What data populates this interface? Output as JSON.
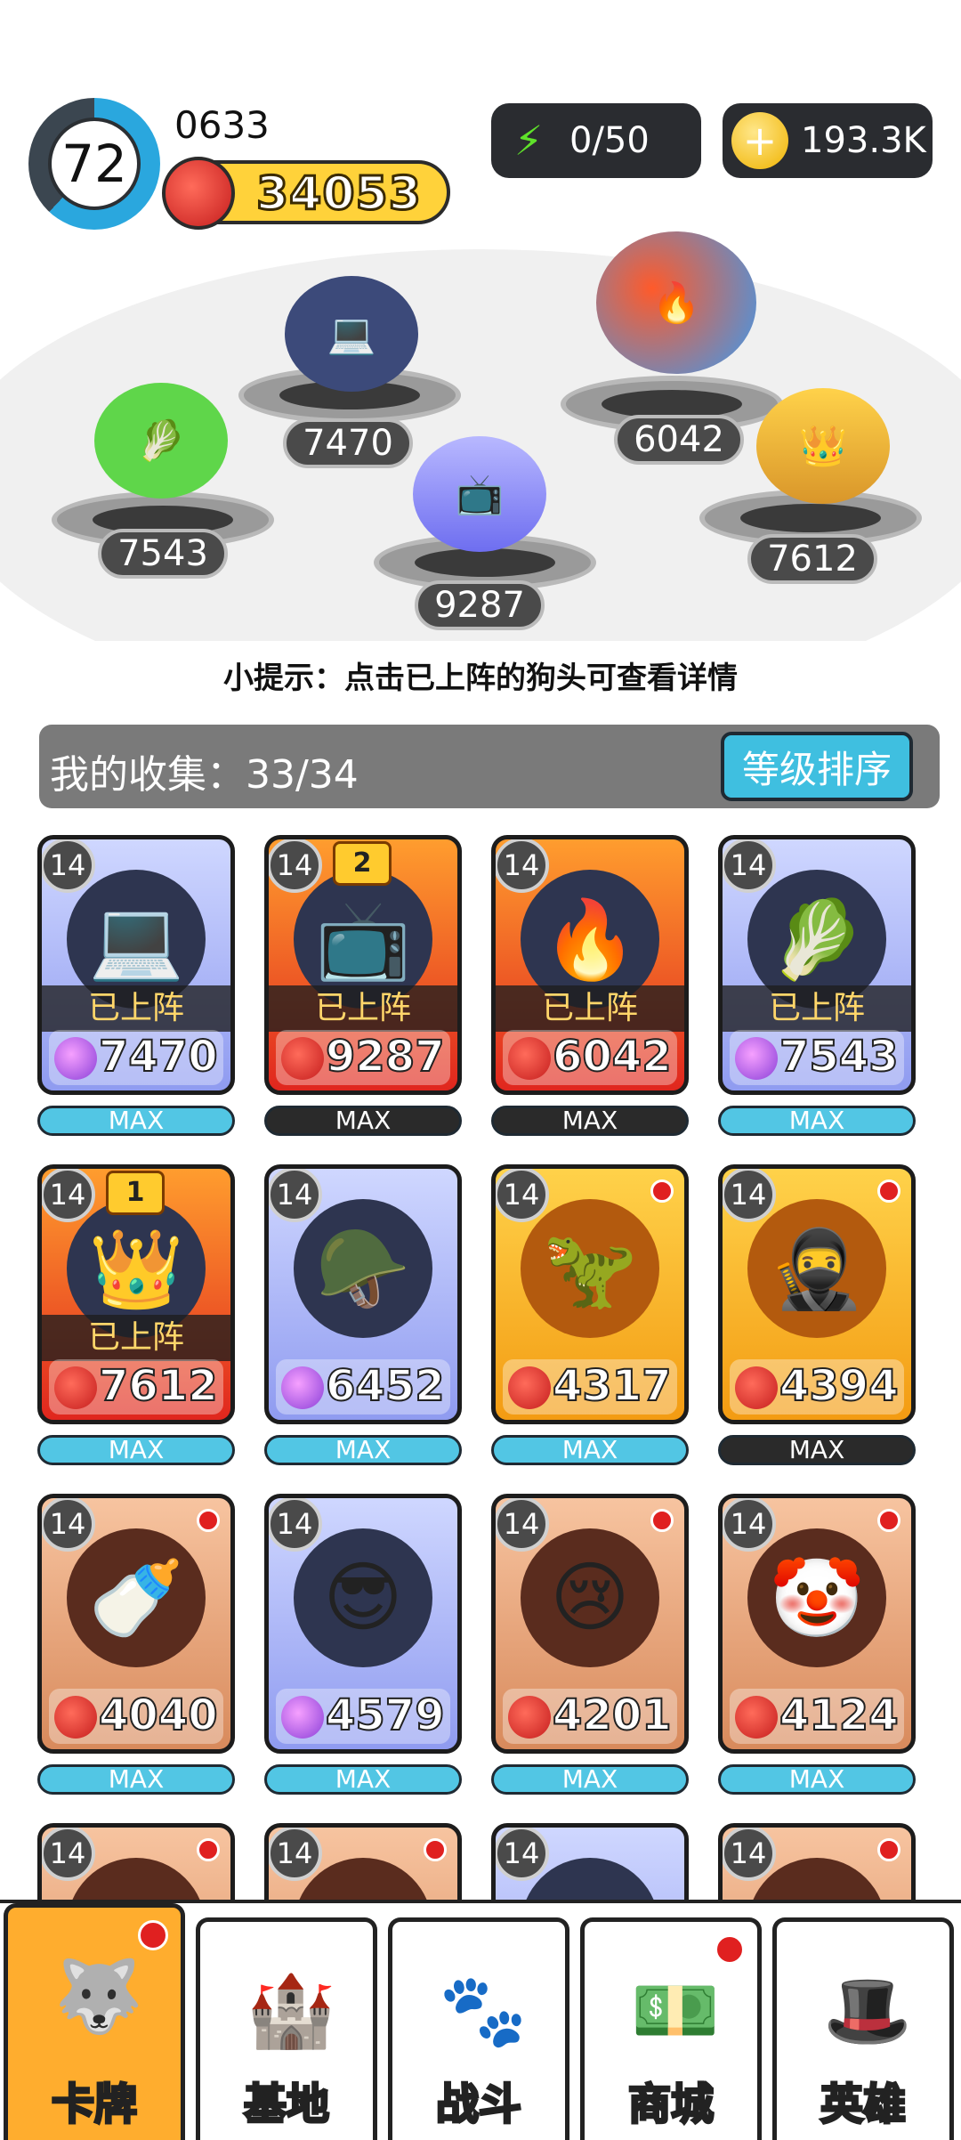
{
  "player": {
    "level": "72",
    "level_progress": 0.62,
    "id": "0633",
    "power": "34053",
    "energy": "0/50",
    "coins": "193.3K"
  },
  "icons": {
    "energy": "lightning-plus-icon",
    "coins": "coin-plus-icon",
    "power": "fist-power-icon"
  },
  "arena": {
    "heroes": [
      {
        "name": "cabbage-dog",
        "value": "7543"
      },
      {
        "name": "laptop-dog",
        "value": "7470"
      },
      {
        "name": "glitch-dog",
        "value": "9287"
      },
      {
        "name": "fire-ice-dog",
        "value": "6042"
      },
      {
        "name": "armored-dog",
        "value": "7612"
      }
    ]
  },
  "hint": "小提示：点击已上阵的狗头可查看详情",
  "collection": {
    "label": "我的收集：33/34",
    "sort_button": "等级排序"
  },
  "cards": [
    {
      "level": "14",
      "power": "7470",
      "deployed": "已上阵",
      "max": "MAX",
      "theme": "blue",
      "glyph": "💻",
      "max_style": "cyan"
    },
    {
      "level": "14",
      "power": "9287",
      "deployed": "已上阵",
      "max": "MAX",
      "theme": "red",
      "glyph": "📺",
      "star": "2",
      "max_style": "dark"
    },
    {
      "level": "14",
      "power": "6042",
      "deployed": "已上阵",
      "max": "MAX",
      "theme": "red",
      "glyph": "🔥",
      "max_style": "dark"
    },
    {
      "level": "14",
      "power": "7543",
      "deployed": "已上阵",
      "max": "MAX",
      "theme": "blue",
      "glyph": "🥬",
      "max_style": "cyan"
    },
    {
      "level": "14",
      "power": "7612",
      "deployed": "已上阵",
      "max": "MAX",
      "theme": "red",
      "glyph": "👑",
      "star": "1",
      "max_style": "cyan"
    },
    {
      "level": "14",
      "power": "6452",
      "max": "MAX",
      "theme": "blue",
      "glyph": "🪖",
      "max_style": "cyan"
    },
    {
      "level": "14",
      "power": "4317",
      "max": "MAX",
      "theme": "gold",
      "glyph": "🦖",
      "dot": true,
      "max_style": "cyan"
    },
    {
      "level": "14",
      "power": "4394",
      "max": "MAX",
      "theme": "gold",
      "glyph": "🥷",
      "dot": true,
      "max_style": "dark"
    },
    {
      "level": "14",
      "power": "4040",
      "max": "MAX",
      "theme": "bronze",
      "glyph": "🍼",
      "dot": true,
      "max_style": "cyan"
    },
    {
      "level": "14",
      "power": "4579",
      "max": "MAX",
      "theme": "blue",
      "glyph": "😎",
      "max_style": "cyan"
    },
    {
      "level": "14",
      "power": "4201",
      "max": "MAX",
      "theme": "bronze",
      "glyph": "😢",
      "dot": true,
      "max_style": "cyan"
    },
    {
      "level": "14",
      "power": "4124",
      "max": "MAX",
      "theme": "bronze",
      "glyph": "🤡",
      "dot": true,
      "max_style": "cyan"
    },
    {
      "level": "14",
      "theme": "bronze",
      "dot": true
    },
    {
      "level": "14",
      "theme": "bronze",
      "dot": true
    },
    {
      "level": "14",
      "theme": "blue"
    },
    {
      "level": "14",
      "theme": "bronze",
      "dot": true
    }
  ],
  "nav": [
    {
      "label": "卡牌",
      "icon": "husky-icon",
      "glyph": "🐺",
      "active": true,
      "dot": true
    },
    {
      "label": "基地",
      "icon": "castle-icon",
      "glyph": "🏰"
    },
    {
      "label": "战斗",
      "icon": "paw-icon",
      "glyph": "🐾"
    },
    {
      "label": "商城",
      "icon": "money-icon",
      "glyph": "💵",
      "dot": true
    },
    {
      "label": "英雄",
      "icon": "top-hat-dog-icon",
      "glyph": "🎩"
    }
  ]
}
